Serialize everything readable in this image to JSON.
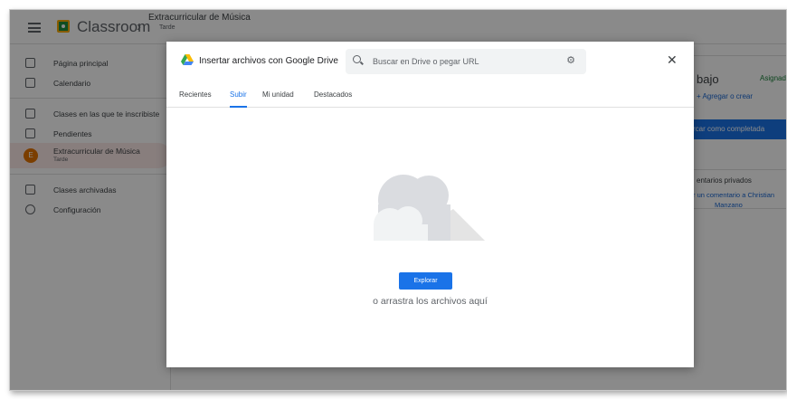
{
  "app": {
    "brand": "Classroom",
    "breadcrumb_title": "Extracurricular de Música",
    "breadcrumb_subtitle": "Tarde"
  },
  "sidebar": {
    "items": [
      {
        "label": "Página principal",
        "icon": "home-icon"
      },
      {
        "label": "Calendario",
        "icon": "calendar-icon"
      },
      {
        "label": "Clases en las que te inscribiste",
        "icon": "school-icon"
      },
      {
        "label": "Pendientes",
        "icon": "assignment-icon"
      },
      {
        "label": "Extracurricular de Música",
        "sub": "Tarde",
        "avatar": "E",
        "icon": "class-avatar"
      },
      {
        "label": "Clases archivadas",
        "icon": "archive-icon"
      },
      {
        "label": "Configuración",
        "icon": "gear-icon"
      }
    ]
  },
  "right_panel": {
    "title": "bajo",
    "status": "Asignad",
    "add": "+ Agregar o crear",
    "mark": "rcar como completada",
    "private_comments": "entarios privados",
    "comment_link": "r un comentario a Christian",
    "comment_link2": "Manzano"
  },
  "modal": {
    "title": "Insertar archivos con Google Drive",
    "search_placeholder": "Buscar en Drive o pegar URL",
    "close_label": "✕",
    "tabs": [
      "Recientes",
      "Subir",
      "Mi unidad",
      "Destacados"
    ],
    "selected_tab": "Subir",
    "explore_label": "Explorar",
    "drag_text": "o arrastra los archivos aquí"
  },
  "colors": {
    "accent": "#1a73e8",
    "brand_green": "#1e8e3e",
    "avatar": "#e37400"
  }
}
